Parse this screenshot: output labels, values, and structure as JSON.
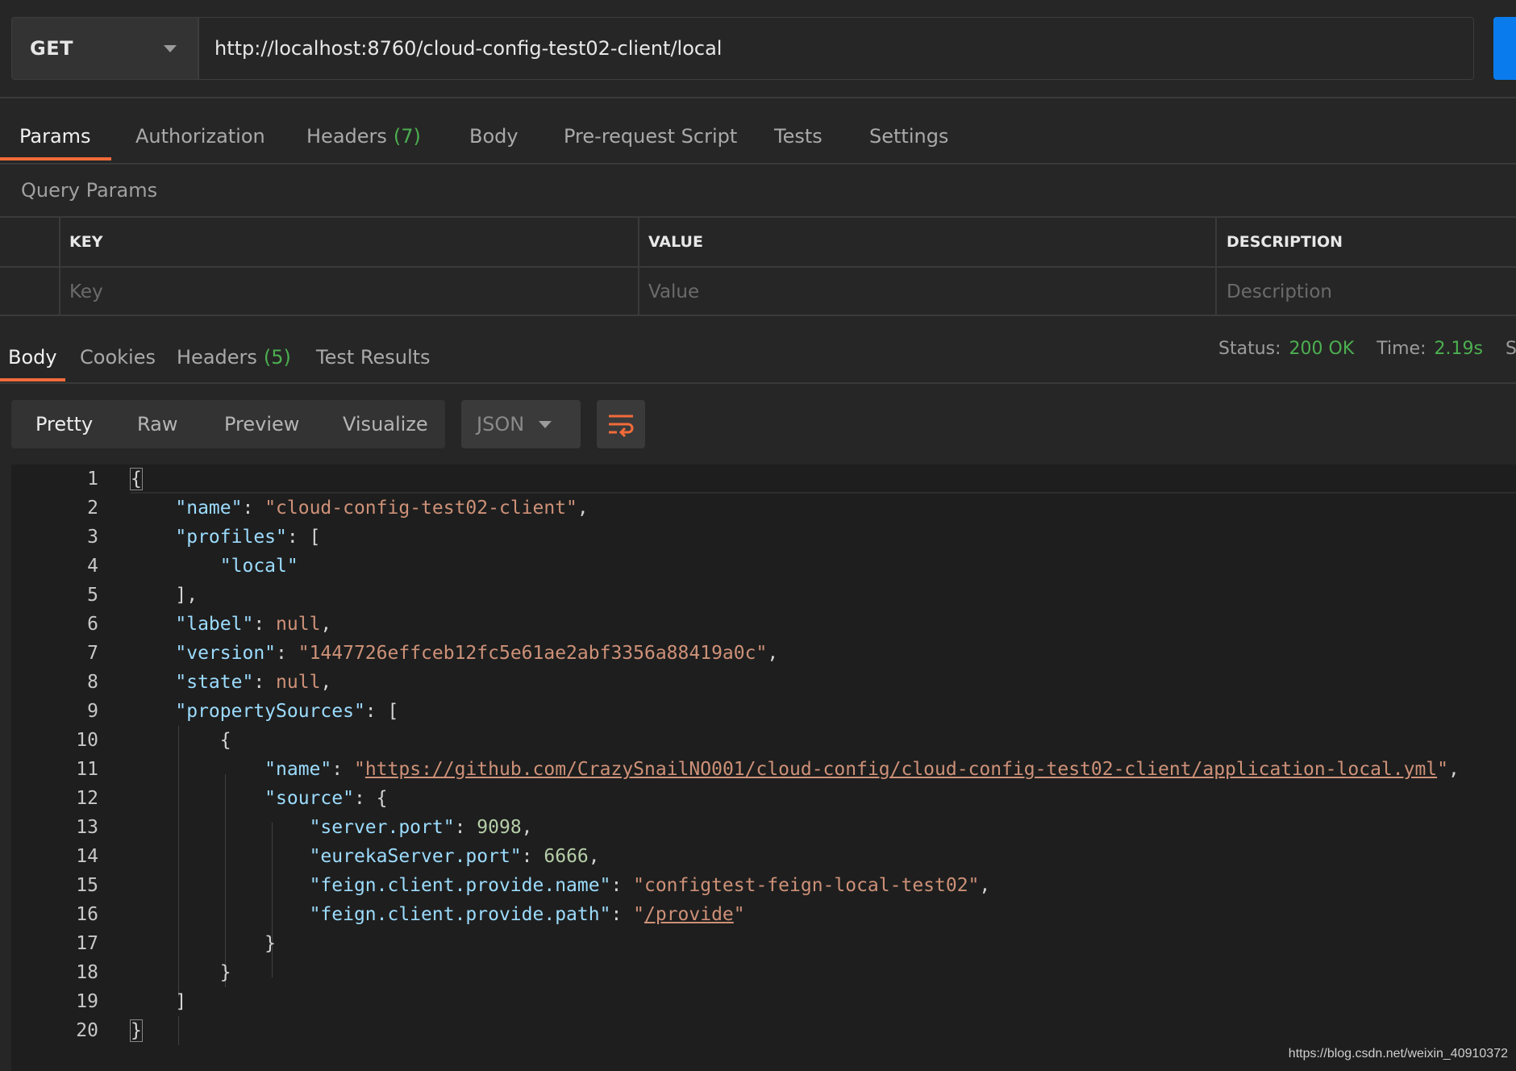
{
  "request": {
    "method": "GET",
    "url": "http://localhost:8760/cloud-config-test02-client/local"
  },
  "request_tabs": [
    {
      "label": "Params",
      "count": "",
      "active": true
    },
    {
      "label": "Authorization",
      "count": ""
    },
    {
      "label": "Headers",
      "count": "(7)"
    },
    {
      "label": "Body",
      "count": ""
    },
    {
      "label": "Pre-request Script",
      "count": ""
    },
    {
      "label": "Tests",
      "count": ""
    },
    {
      "label": "Settings",
      "count": ""
    }
  ],
  "query_params": {
    "title": "Query Params",
    "headers": {
      "key": "KEY",
      "value": "VALUE",
      "description": "DESCRIPTION"
    },
    "placeholders": {
      "key": "Key",
      "value": "Value",
      "description": "Description"
    }
  },
  "response_tabs": [
    {
      "label": "Body",
      "count": "",
      "active": true
    },
    {
      "label": "Cookies",
      "count": ""
    },
    {
      "label": "Headers",
      "count": "(5)"
    },
    {
      "label": "Test Results",
      "count": ""
    }
  ],
  "status": {
    "status_label": "Status:",
    "status_value": "200 OK",
    "time_label": "Time:",
    "time_value": "2.19s",
    "size_label": "Size"
  },
  "view_modes": [
    "Pretty",
    "Raw",
    "Preview",
    "Visualize"
  ],
  "active_view": "Pretty",
  "format": "JSON",
  "code_lines": [
    "{",
    "    \"name\": \"cloud-config-test02-client\",",
    "    \"profiles\": [",
    "        \"local\"",
    "    ],",
    "    \"label\": null,",
    "    \"version\": \"1447726effceb12fc5e61ae2abf3356a88419a0c\",",
    "    \"state\": null,",
    "    \"propertySources\": [",
    "        {",
    "            \"name\": \"https://github.com/CrazySnailNO001/cloud-config/cloud-config-test02-client/application-local.yml\",",
    "            \"source\": {",
    "                \"server.port\": 9098,",
    "                \"eurekaServer.port\": 6666,",
    "                \"feign.client.provide.name\": \"configtest-feign-local-test02\",",
    "                \"feign.client.provide.path\": \"/provide\"",
    "            }",
    "        }",
    "    ]",
    "}"
  ],
  "watermark": "https://blog.csdn.net/weixin_40910372",
  "colors": {
    "accent": "#f26b3a",
    "send": "#097bed",
    "success": "#4caf50"
  }
}
